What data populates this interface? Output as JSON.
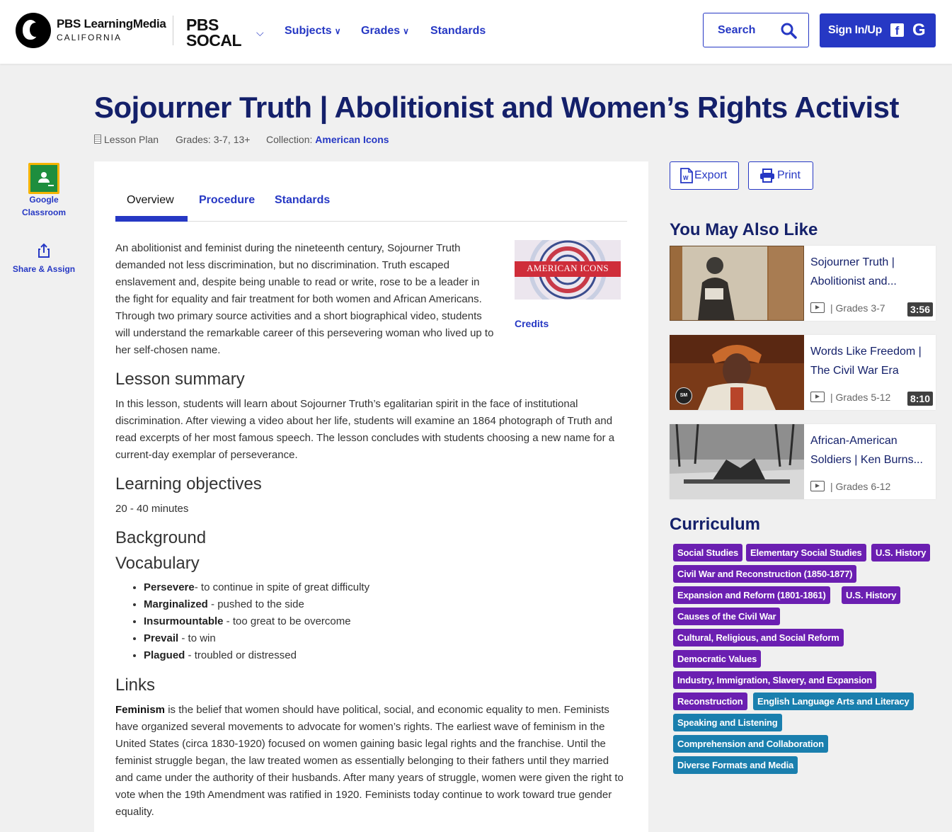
{
  "header": {
    "brand_name": "PBS LearningMedia",
    "brand_region": "CALIFORNIA",
    "station_line1": "PBS",
    "station_line2": "SOCAL",
    "nav": [
      "Subjects",
      "Grades",
      "Standards"
    ],
    "search_label": "Search",
    "signin_label": "Sign In/Up",
    "facebook_glyph": "f",
    "google_glyph": "G"
  },
  "page": {
    "title": "Sojourner Truth | Abolitionist and Women’s Rights Activist",
    "type": "Lesson Plan",
    "grades": "Grades: 3-7, 13+",
    "collection_label": "Collection:",
    "collection": "American Icons"
  },
  "sidebar": {
    "google_classroom": [
      "Google",
      "Classroom"
    ],
    "share_assign": "Share & Assign"
  },
  "tabs": [
    "Overview",
    "Procedure",
    "Standards"
  ],
  "content": {
    "intro": "An abolitionist and feminist during the nineteenth century, Sojourner Truth demanded not less discrimination, but no discrimination. Truth escaped enslavement and, despite being unable to read or write, rose to be a leader in the fight for equality and fair treatment for both women and African Americans. Through two primary source activities and a short biographical video, students will understand the remarkable career of this persevering woman who lived up to her self-chosen name.",
    "thumb_caption": "AMERICAN ICONS",
    "credits": "Credits",
    "h_summary": "Lesson summary",
    "summary": "In this lesson, students will learn about Sojourner Truth’s egalitarian spirit in the face of institutional discrimination. After viewing a video about her life, students will examine an 1864 photograph of Truth and read excerpts of her most famous speech. The lesson concludes with students choosing a new name for a current-day exemplar of perseverance.",
    "h_objectives": "Learning objectives",
    "time": "20 - 40 minutes",
    "h_background": "Background",
    "h_vocab": "Vocabulary",
    "vocab": [
      {
        "term": "Persevere",
        "def": "- to continue in spite of great difficulty"
      },
      {
        "term": "Marginalized",
        "def": " - pushed to the side"
      },
      {
        "term": "Insurmountable",
        "def": " - too great to be overcome"
      },
      {
        "term": "Prevail",
        "def": " - to win"
      },
      {
        "term": "Plagued",
        "def": " - troubled or distressed"
      }
    ],
    "h_links": "Links",
    "feminism_term": "Feminism",
    "feminism_text": " is the belief that women should have political, social, and economic equality to men. Feminists have organized several movements to advocate for women’s rights. The earliest wave of feminism in the United States (circa 1830-1920) focused on women gaining basic legal rights and the franchise. Until the feminist struggle began, the law treated women as essentially belonging to their fathers until they married and came under the authority of their husbands. After many years of struggle, women were given the right to vote when the 19th Amendment was ratified in 1920. Feminists today continue to work toward true gender equality."
  },
  "actions": {
    "export": "Export",
    "print": "Print",
    "export_badge": "W"
  },
  "related": {
    "heading": "You May Also Like",
    "items": [
      {
        "title": "Sojourner Truth | Abolitionist and...",
        "duration": "3:56",
        "grades": "| Grades 3-7"
      },
      {
        "title": "Words Like Freedom | The Civil War Era",
        "duration": "8:10",
        "grades": "| Grades 5-12",
        "badge": "SM"
      },
      {
        "title": "African-American Soldiers | Ken Burns...",
        "duration": "",
        "grades": "| Grades 6-12"
      }
    ]
  },
  "curriculum": {
    "heading": "Curriculum",
    "tags": [
      "Social Studies",
      "Elementary Social Studies",
      "U.S. History",
      "Civil War and Reconstruction (1850-1877)",
      "Expansion and Reform (1801-1861)",
      "U.S. History",
      "Causes of the Civil War",
      "Cultural, Religious, and Social Reform",
      "Democratic Values",
      "Industry, Immigration, Slavery, and Expansion",
      "Reconstruction",
      "English Language Arts and Literacy",
      "Speaking and Listening",
      "Comprehension and Collaboration",
      "Diverse Formats and Media"
    ],
    "colors": {
      "social": "#6b1fb1",
      "ela": "#1a7fae"
    }
  }
}
